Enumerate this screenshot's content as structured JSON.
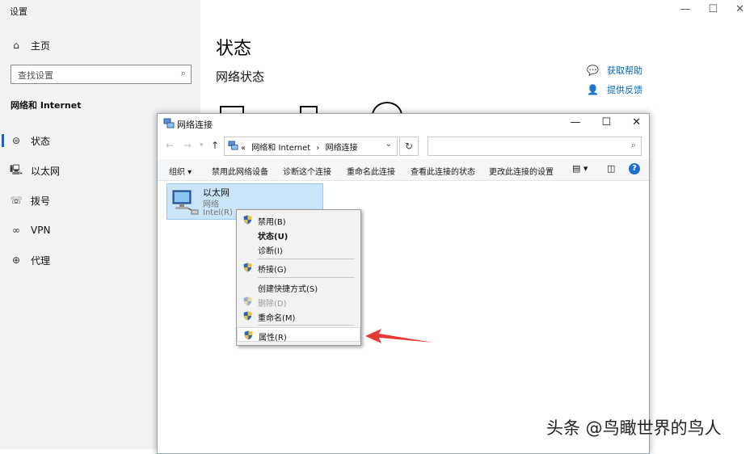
{
  "settings": {
    "title": "设置",
    "search": {
      "placeholder": "查找设置"
    },
    "home_label": "主页",
    "section_title": "网络和 Internet",
    "nav": [
      {
        "label": "状态",
        "icon": "home-network-icon"
      },
      {
        "label": "以太网",
        "icon": "ethernet-icon"
      },
      {
        "label": "拨号",
        "icon": "dialup-icon"
      },
      {
        "label": "VPN",
        "icon": "vpn-icon"
      },
      {
        "label": "代理",
        "icon": "globe-icon"
      }
    ],
    "page_title": "状态",
    "page_subtitle": "网络状态",
    "links": {
      "help": "获取帮助",
      "feedback": "提供反馈"
    }
  },
  "net_window": {
    "title": "网络连接",
    "breadcrumb": {
      "sep": "«",
      "part1": "网络和 Internet",
      "arrow": "›",
      "part2": "网络连接"
    },
    "commands": {
      "organize": "组织 ▾",
      "disable": "禁用此网络设备",
      "diagnose": "诊断这个连接",
      "rename": "重命名此连接",
      "status": "查看此连接的状态",
      "settings": "更改此连接的设置"
    },
    "adapter": {
      "name": "以太网",
      "network": "网络",
      "device": "Intel(R) Et"
    }
  },
  "context_menu": {
    "items": {
      "disable": "禁用(B)",
      "status": "状态(U)",
      "diagnose": "诊断(I)",
      "bridge": "桥接(G)",
      "shortcut": "创建快捷方式(S)",
      "delete": "删除(D)",
      "rename": "重命名(M)",
      "properties": "属性(R)"
    }
  },
  "watermark": "头条 @鸟瞰世界的鸟人",
  "colors": {
    "accent": "#1f5fbf",
    "link": "#0067c0",
    "selection": "#cce4f7",
    "arrow": "#e53935"
  }
}
